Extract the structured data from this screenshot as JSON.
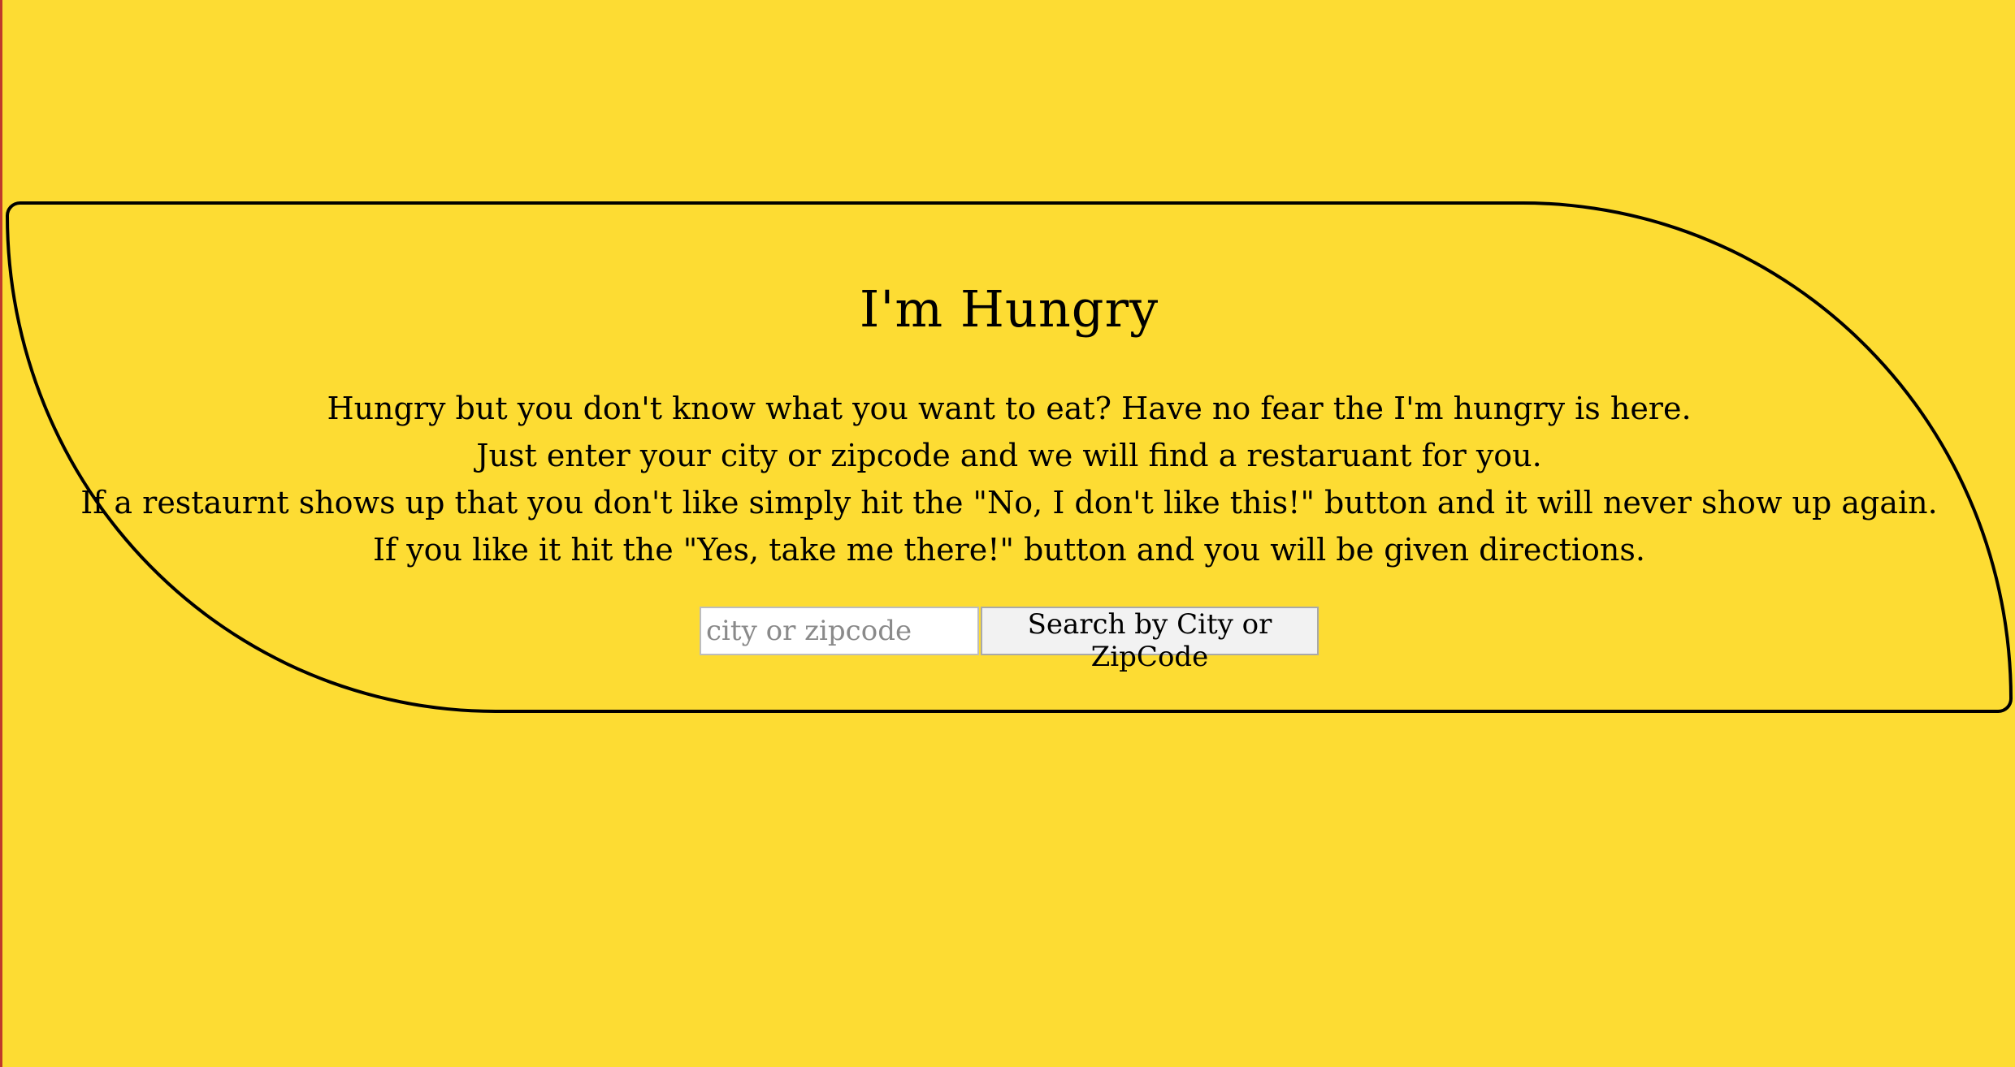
{
  "app": {
    "title": "I'm Hungry"
  },
  "intro": {
    "lines": [
      "Hungry but you don't know what you want to eat? Have no fear the I'm hungry is here.",
      "Just enter your city or zipcode and we will find a restaruant for you.",
      "If a restaurnt shows up that you don't like simply hit the \"No, I don't like this!\" button and it will never show up again.",
      "If you like it hit the \"Yes, take me there!\" button and you will be given directions."
    ]
  },
  "search": {
    "placeholder": "city or zipcode",
    "value": "",
    "button_label": "Search by City or ZipCode"
  },
  "colors": {
    "background": "#FDDC33",
    "border": "#000000"
  }
}
